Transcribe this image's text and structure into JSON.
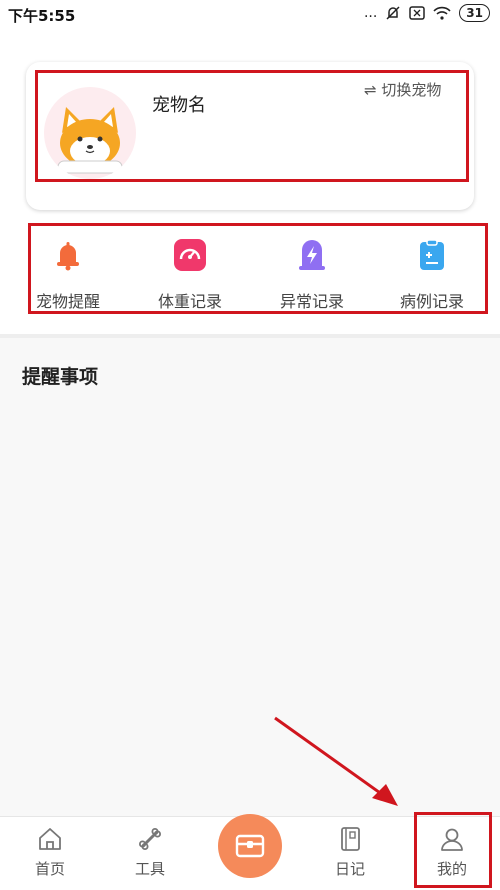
{
  "status_bar": {
    "time": "下午5:55",
    "dots": "...",
    "battery": "31"
  },
  "pet_card": {
    "name": "宠物名",
    "switch_label": "⇌ 切换宠物"
  },
  "functions": [
    {
      "label": "宠物提醒",
      "icon": "bell-icon",
      "color": "#f36b3b"
    },
    {
      "label": "体重记录",
      "icon": "gauge-icon",
      "color": "#f0386b"
    },
    {
      "label": "异常记录",
      "icon": "lightning-icon",
      "color": "#8f6ff2"
    },
    {
      "label": "病例记录",
      "icon": "clipboard-icon",
      "color": "#3aa7ef"
    }
  ],
  "reminders": {
    "title": "提醒事项"
  },
  "bottom_nav": {
    "items": [
      {
        "label": "首页",
        "icon": "home-icon"
      },
      {
        "label": "工具",
        "icon": "bone-icon"
      },
      {
        "label": "",
        "icon": "chest-icon"
      },
      {
        "label": "日记",
        "icon": "notebook-icon"
      },
      {
        "label": "我的",
        "icon": "person-icon"
      }
    ]
  },
  "colors": {
    "annotation": "#d0161e",
    "accent": "#f58a5a"
  }
}
